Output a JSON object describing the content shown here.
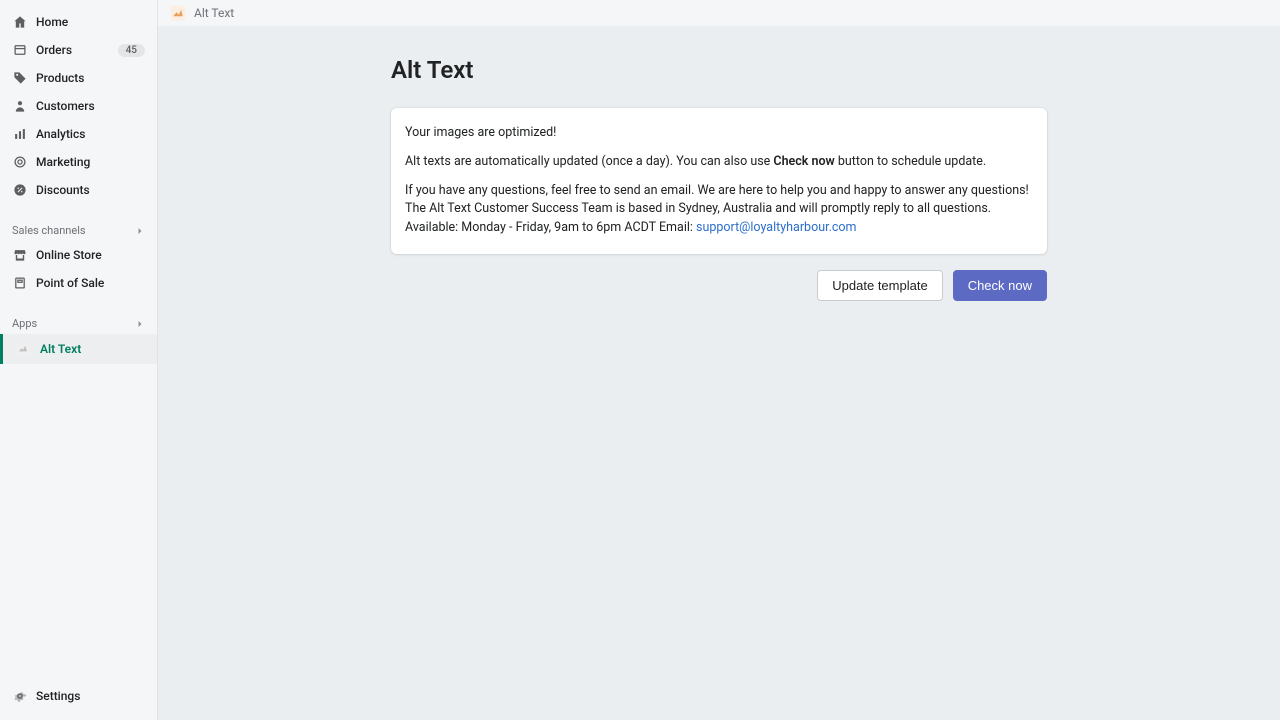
{
  "sidebar": {
    "nav": [
      {
        "label": "Home"
      },
      {
        "label": "Orders",
        "badge": "45"
      },
      {
        "label": "Products"
      },
      {
        "label": "Customers"
      },
      {
        "label": "Analytics"
      },
      {
        "label": "Marketing"
      },
      {
        "label": "Discounts"
      }
    ],
    "sales_channels_header": "Sales channels",
    "sales_channels": [
      {
        "label": "Online Store"
      },
      {
        "label": "Point of Sale"
      }
    ],
    "apps_header": "Apps",
    "apps": [
      {
        "label": "Alt Text"
      }
    ],
    "settings_label": "Settings"
  },
  "topbar": {
    "title": "Alt Text"
  },
  "main": {
    "page_title": "Alt Text",
    "card": {
      "line1": "Your images are optimized!",
      "line2_pre": "Alt texts are automatically updated (once a day). You can also use ",
      "line2_bold": "Check now",
      "line2_post": " button to schedule update.",
      "line3": "If you have any questions, feel free to send an email. We are here to help you and happy to answer any questions! The Alt Text Customer Success Team is based in Sydney, Australia and will promptly reply to all questions. Available: Monday - Friday, 9am to 6pm ACDT Email: ",
      "email": "support@loyaltyharbour.com"
    },
    "buttons": {
      "update_template": "Update template",
      "check_now": "Check now"
    }
  }
}
